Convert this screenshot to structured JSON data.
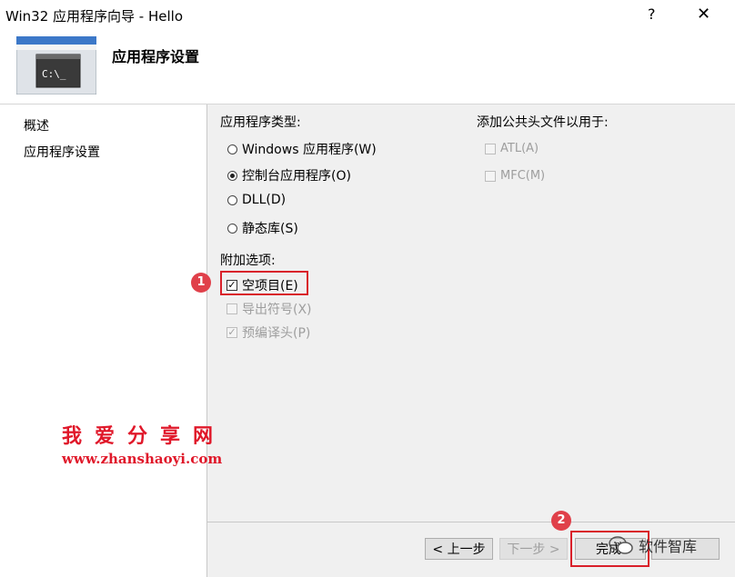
{
  "window": {
    "title": "Win32 应用程序向导 - Hello",
    "help": "?",
    "close": "✕"
  },
  "header": {
    "title": "应用程序设置",
    "icon_text": "C:\\_"
  },
  "sidebar": {
    "items": [
      {
        "label": "概述"
      },
      {
        "label": "应用程序设置"
      }
    ]
  },
  "app_type": {
    "label": "应用程序类型:",
    "options": [
      {
        "label": "Windows 应用程序(W)",
        "selected": false
      },
      {
        "label": "控制台应用程序(O)",
        "selected": true
      },
      {
        "label": "DLL(D)",
        "selected": false
      },
      {
        "label": "静态库(S)",
        "selected": false
      }
    ]
  },
  "headers": {
    "label": "添加公共头文件以用于:",
    "options": [
      {
        "label": "ATL(A)",
        "checked": false,
        "enabled": false
      },
      {
        "label": "MFC(M)",
        "checked": false,
        "enabled": false
      }
    ]
  },
  "extra": {
    "label": "附加选项:",
    "options": [
      {
        "label": "空项目(E)",
        "checked": true,
        "enabled": true
      },
      {
        "label": "导出符号(X)",
        "checked": false,
        "enabled": false
      },
      {
        "label": "预编译头(P)",
        "checked": true,
        "enabled": false
      }
    ]
  },
  "badges": {
    "one": "1",
    "two": "2"
  },
  "watermark": {
    "title": "我爱分享网",
    "url": "www.zhanshaoyi.com",
    "wechat": "软件智库"
  },
  "buttons": {
    "prev": "< 上一步",
    "next": "下一步 >",
    "finish": "完成"
  },
  "colors": {
    "accent_red": "#d9202a"
  }
}
